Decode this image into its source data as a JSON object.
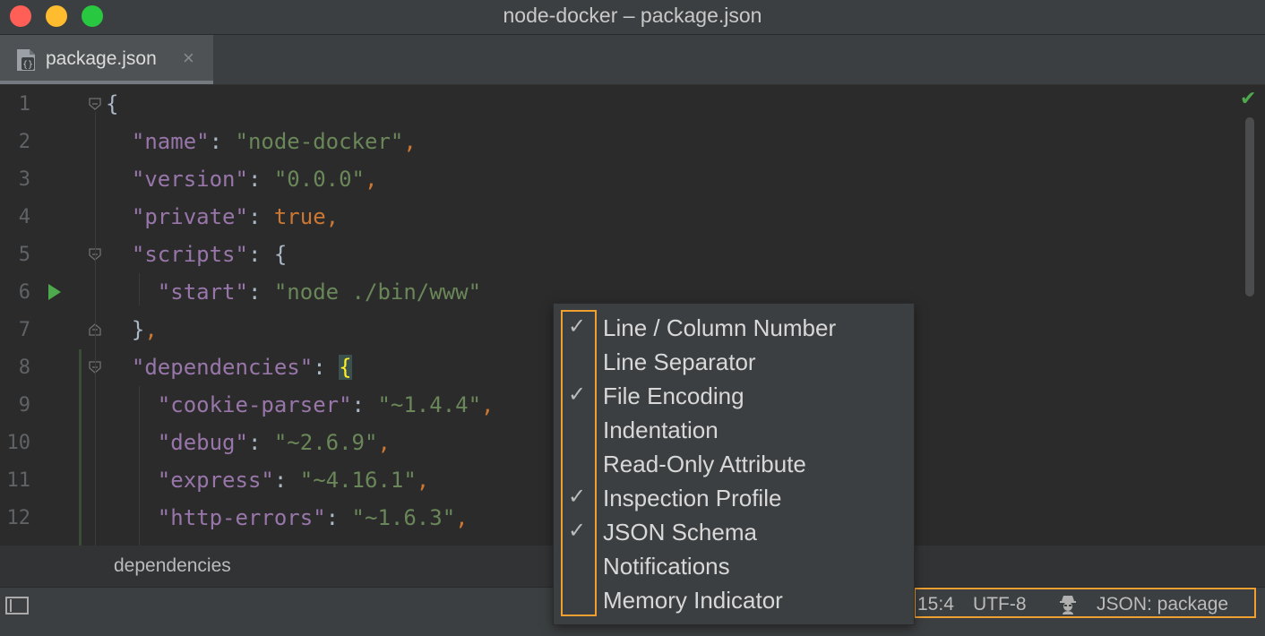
{
  "window": {
    "title": "node-docker – package.json"
  },
  "tab": {
    "label": "package.json",
    "close": "×"
  },
  "editor": {
    "line_numbers": [
      "1",
      "2",
      "3",
      "4",
      "5",
      "6",
      "7",
      "8",
      "9",
      "10",
      "11",
      "12"
    ],
    "lines": [
      [
        {
          "t": "brace",
          "v": "{"
        }
      ],
      [
        {
          "t": "key",
          "v": "  \"name\""
        },
        {
          "t": "brace",
          "v": ": "
        },
        {
          "t": "str",
          "v": "\"node-docker\""
        },
        {
          "t": "kw",
          "v": ","
        }
      ],
      [
        {
          "t": "key",
          "v": "  \"version\""
        },
        {
          "t": "brace",
          "v": ": "
        },
        {
          "t": "str",
          "v": "\"0.0.0\""
        },
        {
          "t": "kw",
          "v": ","
        }
      ],
      [
        {
          "t": "key",
          "v": "  \"private\""
        },
        {
          "t": "brace",
          "v": ": "
        },
        {
          "t": "kw",
          "v": "true,"
        }
      ],
      [
        {
          "t": "key",
          "v": "  \"scripts\""
        },
        {
          "t": "brace",
          "v": ": {"
        }
      ],
      [
        {
          "t": "key",
          "v": "    \"start\""
        },
        {
          "t": "brace",
          "v": ": "
        },
        {
          "t": "str",
          "v": "\"node ./bin/www\""
        }
      ],
      [
        {
          "t": "brace",
          "v": "  }"
        },
        {
          "t": "kw",
          "v": ","
        }
      ],
      [
        {
          "t": "key",
          "v": "  \"dependencies\""
        },
        {
          "t": "brace",
          "v": ": "
        },
        {
          "t": "brace-hl",
          "v": "{"
        }
      ],
      [
        {
          "t": "key",
          "v": "    \"cookie-parser\""
        },
        {
          "t": "brace",
          "v": ": "
        },
        {
          "t": "str",
          "v": "\"~1.4.4\""
        },
        {
          "t": "kw",
          "v": ","
        }
      ],
      [
        {
          "t": "key",
          "v": "    \"debug\""
        },
        {
          "t": "brace",
          "v": ": "
        },
        {
          "t": "str",
          "v": "\"~2.6.9\""
        },
        {
          "t": "kw",
          "v": ","
        }
      ],
      [
        {
          "t": "key",
          "v": "    \"express\""
        },
        {
          "t": "brace",
          "v": ": "
        },
        {
          "t": "str",
          "v": "\"~4.16.1\""
        },
        {
          "t": "kw",
          "v": ","
        }
      ],
      [
        {
          "t": "key",
          "v": "    \"http-errors\""
        },
        {
          "t": "brace",
          "v": ": "
        },
        {
          "t": "str",
          "v": "\"~1.6.3\""
        },
        {
          "t": "kw",
          "v": ","
        }
      ]
    ]
  },
  "breadcrumb": {
    "text": "dependencies"
  },
  "statusbar": {
    "position": "15:4",
    "encoding": "UTF-8",
    "schema": "JSON: package"
  },
  "popup_menu": {
    "items": [
      {
        "label": "Line / Column Number",
        "checked": true
      },
      {
        "label": "Line Separator",
        "checked": false
      },
      {
        "label": "File Encoding",
        "checked": true
      },
      {
        "label": "Indentation",
        "checked": false
      },
      {
        "label": "Read-Only Attribute",
        "checked": false
      },
      {
        "label": "Inspection Profile",
        "checked": true
      },
      {
        "label": "JSON Schema",
        "checked": true
      },
      {
        "label": "Notifications",
        "checked": false
      },
      {
        "label": "Memory Indicator",
        "checked": false
      }
    ],
    "check_glyph": "✓"
  },
  "icons": {
    "file": "json-file-icon",
    "run": "run-icon",
    "ok": "inspection-ok-icon",
    "panel": "tool-window-toggle-icon",
    "inspector": "inspector-icon"
  },
  "colors": {
    "highlight_border": "#f0a030",
    "key": "#9876aa",
    "string": "#6a8759",
    "keyword": "#cc7832",
    "run": "#4ea84c"
  }
}
